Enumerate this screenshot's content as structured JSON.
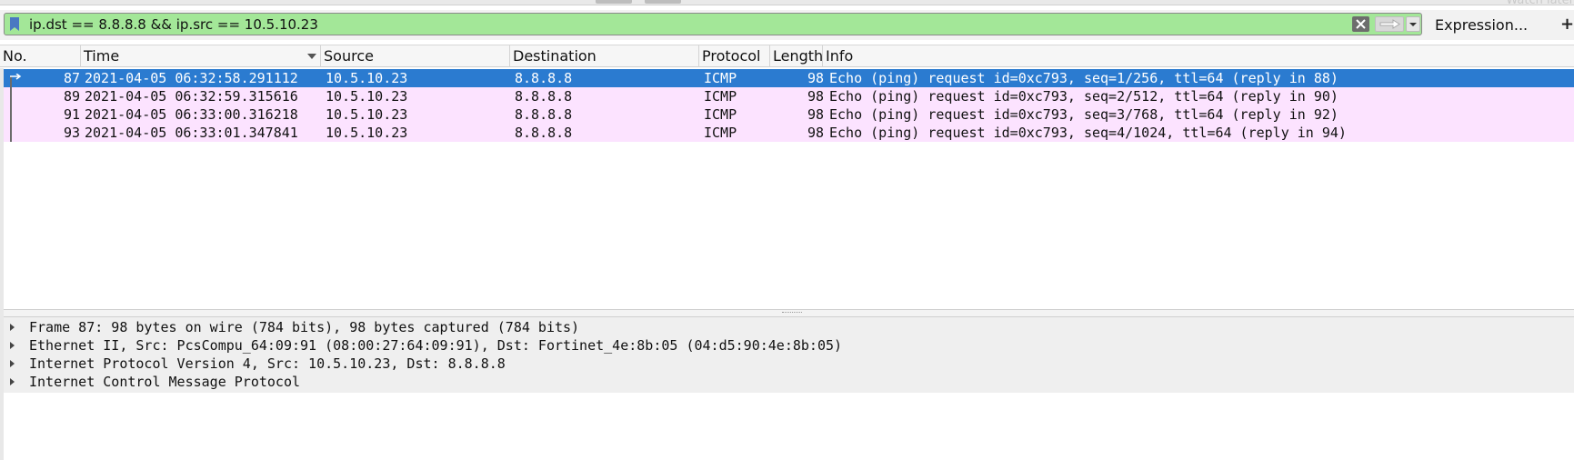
{
  "overlay": {
    "watch_later": "Watch later"
  },
  "filter": {
    "value": "ip.dst == 8.8.8.8 && ip.src == 10.5.10.23",
    "expression_label": "Expression...",
    "add_label": "+",
    "bg_color": "#a3e798",
    "icons": [
      "bookmark-icon",
      "clear-icon",
      "apply-arrow-icon",
      "dropdown-arrow-icon"
    ]
  },
  "columns": [
    "No.",
    "Time",
    "Source",
    "Destination",
    "Protocol",
    "Length",
    "Info"
  ],
  "packets": [
    {
      "no": "87",
      "time": "2021-04-05 06:32:58.291112",
      "source": "10.5.10.23",
      "destination": "8.8.8.8",
      "protocol": "ICMP",
      "length": "98",
      "info": "Echo (ping) request  id=0xc793, seq=1/256, ttl=64 (reply in 88)",
      "selected": true
    },
    {
      "no": "89",
      "time": "2021-04-05 06:32:59.315616",
      "source": "10.5.10.23",
      "destination": "8.8.8.8",
      "protocol": "ICMP",
      "length": "98",
      "info": "Echo (ping) request  id=0xc793, seq=2/512, ttl=64 (reply in 90)",
      "selected": false
    },
    {
      "no": "91",
      "time": "2021-04-05 06:33:00.316218",
      "source": "10.5.10.23",
      "destination": "8.8.8.8",
      "protocol": "ICMP",
      "length": "98",
      "info": "Echo (ping) request  id=0xc793, seq=3/768, ttl=64 (reply in 92)",
      "selected": false
    },
    {
      "no": "93",
      "time": "2021-04-05 06:33:01.347841",
      "source": "10.5.10.23",
      "destination": "8.8.8.8",
      "protocol": "ICMP",
      "length": "98",
      "info": "Echo (ping) request  id=0xc793, seq=4/1024, ttl=64 (reply in 94)",
      "selected": false
    }
  ],
  "colors": {
    "row_bg": "#fce3ff",
    "selected_bg": "#2b7bd0",
    "selected_fg": "#ffffff"
  },
  "details": [
    "Frame 87: 98 bytes on wire (784 bits), 98 bytes captured (784 bits)",
    "Ethernet II, Src: PcsCompu_64:09:91 (08:00:27:64:09:91), Dst: Fortinet_4e:8b:05 (04:d5:90:4e:8b:05)",
    "Internet Protocol Version 4, Src: 10.5.10.23, Dst: 8.8.8.8",
    "Internet Control Message Protocol"
  ]
}
